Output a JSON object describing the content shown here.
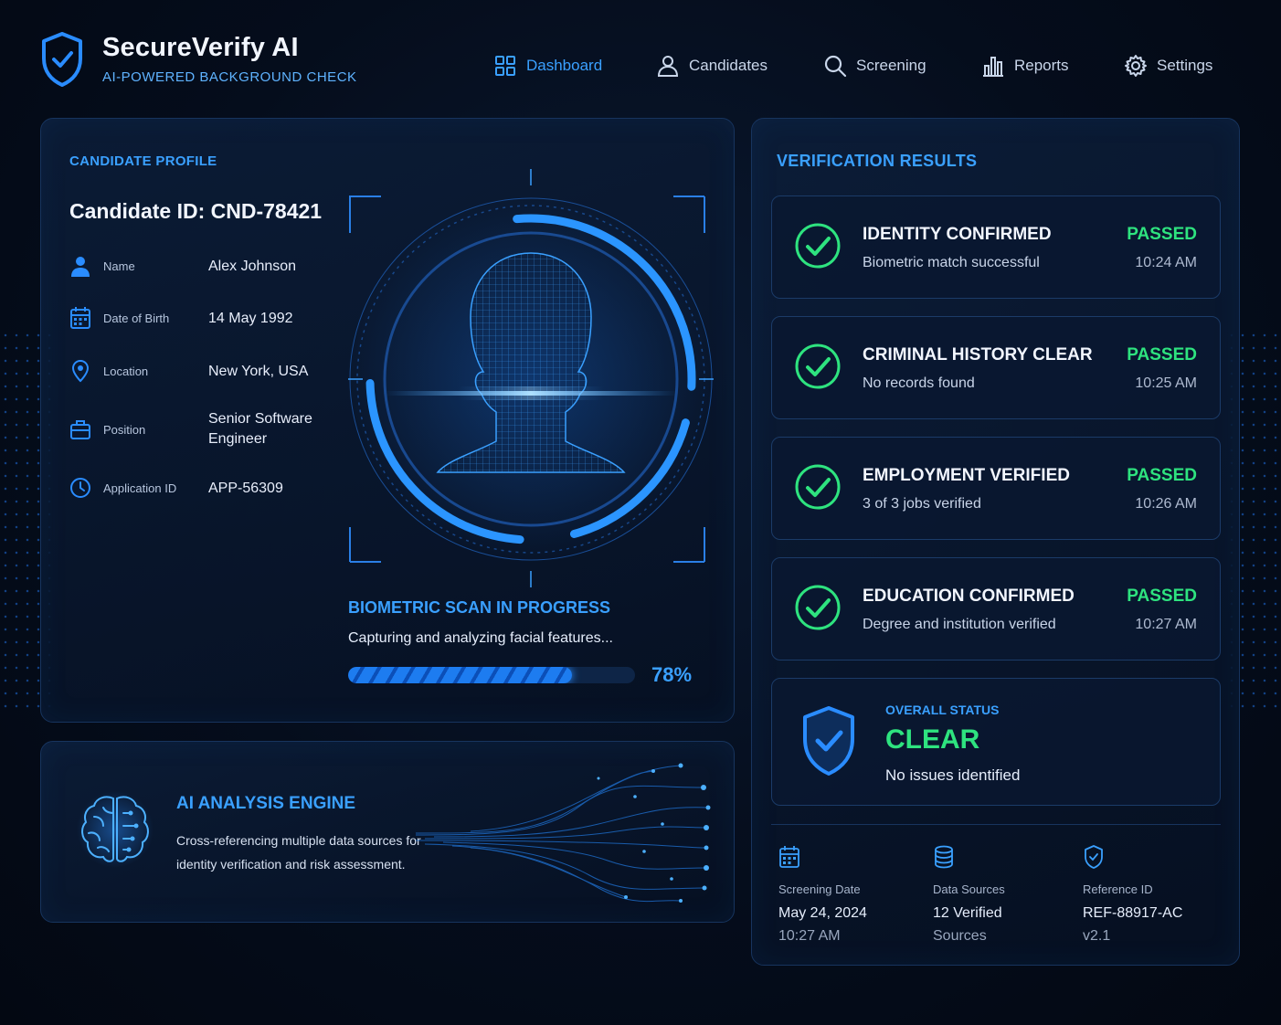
{
  "brand": {
    "title": "SecureVerify AI",
    "subtitle": "AI-POWERED BACKGROUND CHECK"
  },
  "nav": [
    {
      "label": "Dashboard",
      "icon": "grid-icon",
      "active": true
    },
    {
      "label": "Candidates",
      "icon": "user-icon",
      "active": false
    },
    {
      "label": "Screening",
      "icon": "search-icon",
      "active": false
    },
    {
      "label": "Reports",
      "icon": "bar-chart-icon",
      "active": false
    },
    {
      "label": "Settings",
      "icon": "gear-icon",
      "active": false
    }
  ],
  "profile": {
    "section_label": "CANDIDATE PROFILE",
    "candidate_id": "Candidate ID: CND-78421",
    "fields": [
      {
        "label": "Name",
        "value": "Alex Johnson",
        "icon": "user-icon"
      },
      {
        "label": "Date of Birth",
        "value": "14 May 1992",
        "icon": "calendar-icon"
      },
      {
        "label": "Location",
        "value": "New York, USA",
        "icon": "location-pin-icon"
      },
      {
        "label": "Position",
        "value": "Senior Software Engineer",
        "icon": "briefcase-icon"
      },
      {
        "label": "Application ID",
        "value": "APP-56309",
        "icon": "clock-icon"
      }
    ]
  },
  "scan": {
    "title": "BIOMETRIC SCAN IN PROGRESS",
    "subtitle": "Capturing and analyzing facial features...",
    "progress_label": "78%",
    "progress": 0.78
  },
  "ai_engine": {
    "title": "AI ANALYSIS ENGINE",
    "description": "Cross-referencing multiple data sources for identity verification and risk assessment."
  },
  "results": {
    "section_label": "VERIFICATION RESULTS",
    "items": [
      {
        "title": "IDENTITY CONFIRMED",
        "desc": "Biometric match successful",
        "status": "PASSED",
        "time": "10:24 AM"
      },
      {
        "title": "CRIMINAL HISTORY CLEAR",
        "desc": "No records found",
        "status": "PASSED",
        "time": "10:25 AM"
      },
      {
        "title": "EMPLOYMENT VERIFIED",
        "desc": "3 of 3 jobs verified",
        "status": "PASSED",
        "time": "10:26 AM"
      },
      {
        "title": "EDUCATION CONFIRMED",
        "desc": "Degree and institution verified",
        "status": "PASSED",
        "time": "10:27 AM"
      }
    ],
    "overall": {
      "label": "OVERALL STATUS",
      "status": "CLEAR",
      "desc": "No issues identified"
    },
    "meta": [
      {
        "label": "Screening Date",
        "value": "May 24, 2024",
        "sub": "10:27 AM",
        "icon": "calendar-icon"
      },
      {
        "label": "Data Sources",
        "value": "12 Verified",
        "sub": "Sources",
        "icon": "database-icon"
      },
      {
        "label": "Reference ID",
        "value": "REF-88917-AC",
        "sub": "v2.1",
        "icon": "shield-check-icon"
      }
    ]
  },
  "colors": {
    "accent": "#3aa0ff",
    "success": "#2ee37f",
    "background": "#050d1c"
  }
}
